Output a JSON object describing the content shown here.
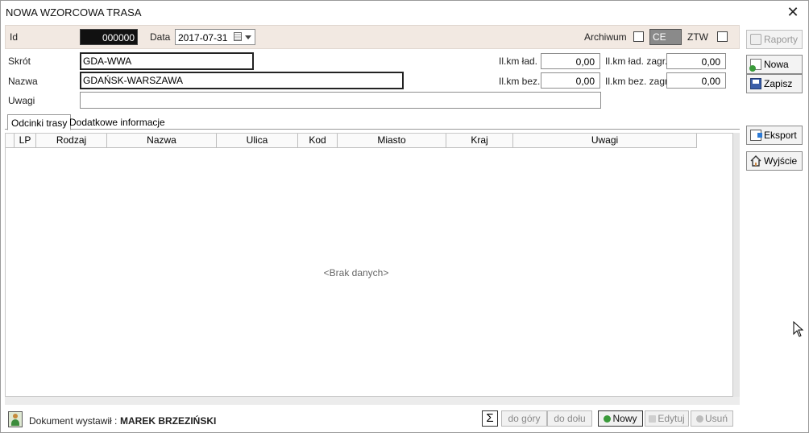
{
  "window": {
    "title": "NOWA WZORCOWA TRASA",
    "close_glyph": "✕"
  },
  "header": {
    "id_label": "Id",
    "id_value": "000000",
    "data_label": "Data",
    "data_value": "2017-07-31",
    "archiwum_label": "Archiwum",
    "ce_value": "CE",
    "ztw_label": "ZTW"
  },
  "form": {
    "skrot_label": "Skrót",
    "skrot_value": "GDA-WWA",
    "nazwa_label": "Nazwa",
    "nazwa_value": "GDAŃSK-WARSZAWA",
    "uwagi_label": "Uwagi",
    "uwagi_value": "",
    "km_lad_label": "Il.km ład.",
    "km_lad_value": "0,00",
    "km_bez_label": "Il.km bez.",
    "km_bez_value": "0,00",
    "km_lad_zagr_label": "Il.km ład. zagr.",
    "km_lad_zagr_value": "0,00",
    "km_bez_zagr_label": "Il.km bez. zagr.",
    "km_bez_zagr_value": "0,00"
  },
  "tabs": [
    {
      "label": "Odcinki trasy"
    },
    {
      "label": "Dodatkowe informacje"
    }
  ],
  "grid": {
    "columns": [
      "LP",
      "Rodzaj",
      "Nazwa",
      "Ulica",
      "Kod",
      "Miasto",
      "Kraj",
      "Uwagi"
    ],
    "empty_text": "<Brak danych>"
  },
  "side_buttons": {
    "raporty": "Raporty",
    "nowa": "Nowa",
    "zapisz": "Zapisz",
    "eksport": "Eksport",
    "wyjscie": "Wyjście"
  },
  "footer": {
    "issuer_label": "Dokument wystawił :",
    "issuer_name": "MAREK BRZEZIŃSKI",
    "sigma": "Σ",
    "up": "do góry",
    "down": "do dołu",
    "new": "Nowy",
    "edit": "Edytuj",
    "delete": "Usuń"
  }
}
